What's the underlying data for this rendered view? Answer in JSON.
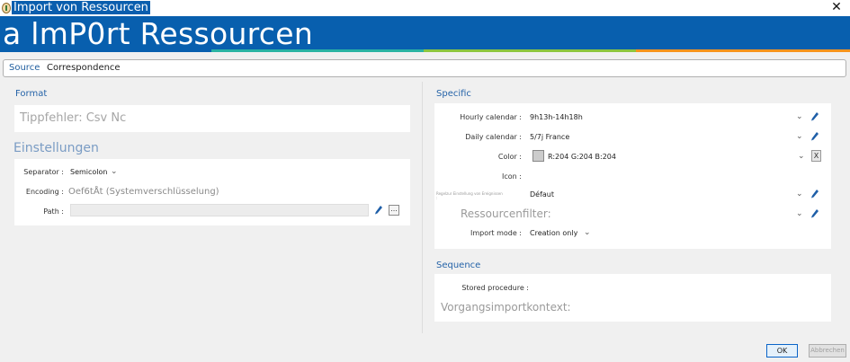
{
  "window": {
    "title": "Import von Ressourcen",
    "close_symbol": "✕",
    "icon": "app-icon"
  },
  "banner": {
    "title": "a lmP0rt Ressourcen",
    "stripe_colors": [
      "#2ab3a3",
      "#8cc63f",
      "#f7941d"
    ]
  },
  "source": {
    "label": "Source",
    "value": "Correspondence"
  },
  "left": {
    "format": {
      "title": "Format",
      "value": "Tippfehler: Csv Nc"
    },
    "settings": {
      "title": "Einstellungen",
      "separator_label": "Separator :",
      "separator_value": "Semicolon",
      "encoding_label": "Encoding :",
      "encoding_value": "Oef6tÅt (Systemverschlüsselung)",
      "path_label": "Path :",
      "path_value": "",
      "path_browse": "..."
    }
  },
  "right": {
    "specific": {
      "title": "Specific",
      "hourly_label": "Hourly calendar :",
      "hourly_value": "9h13h-14h18h",
      "daily_label": "Daily calendar :",
      "daily_value": "5/7j France",
      "color_label": "Color :",
      "color_value": "R:204 G:204 B:204",
      "color_swatch": "#cccccc",
      "color_clear": "X",
      "icon_label": "Icon :",
      "reg_label": "Regelzur Einstellung von Ereignissen :",
      "reg_value": "Défaut",
      "resfilter_label": "Ressourcenfilter:",
      "import_mode_label": "Import mode :",
      "import_mode_value": "Creation only"
    },
    "sequence": {
      "title": "Sequence",
      "stored_label": "Stored procedure :",
      "context_label": "Vorgangsimportkontext:"
    }
  },
  "buttons": {
    "ok": "OK",
    "cancel": "Abbrechen"
  },
  "colors": {
    "banner_blue": "#085fae",
    "section_title": "#2563a8",
    "title_highlight": "#0a5eae"
  }
}
